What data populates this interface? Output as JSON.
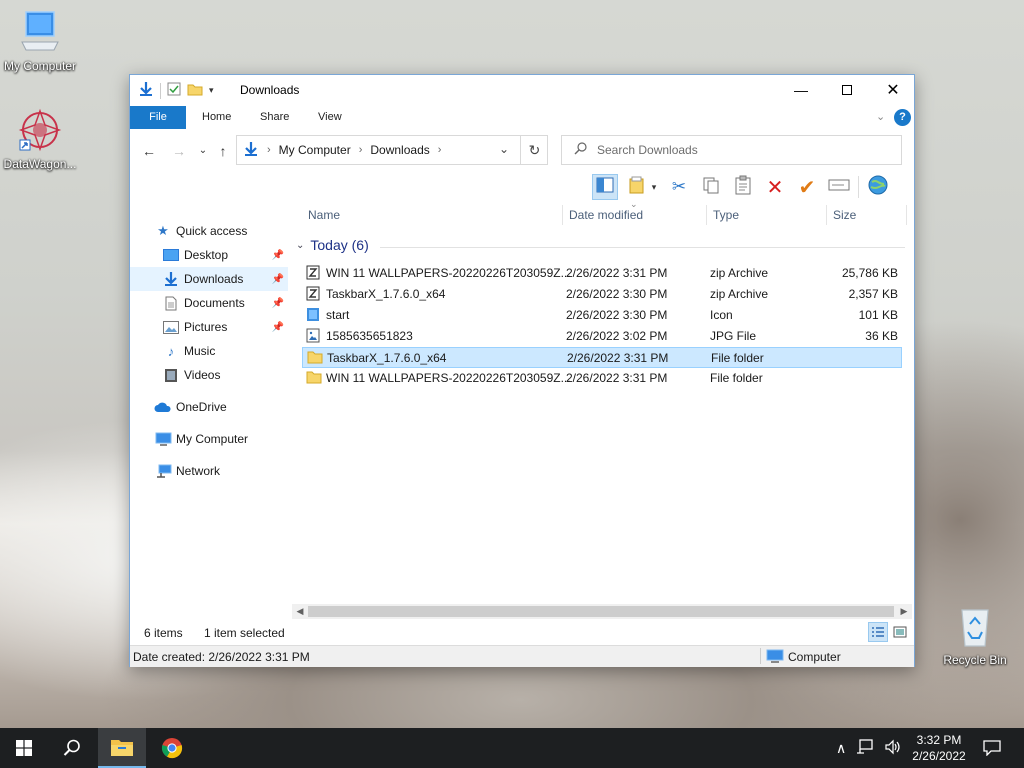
{
  "desktop": {
    "icons": [
      {
        "label": "My Computer"
      },
      {
        "label": "DataWagon..."
      },
      {
        "label": "Recycle Bin"
      }
    ]
  },
  "window": {
    "title": "Downloads",
    "ribbon_tabs": [
      "File",
      "Home",
      "Share",
      "View"
    ],
    "address": {
      "crumbs": [
        "My Computer",
        "Downloads"
      ]
    },
    "search": {
      "placeholder": "Search Downloads"
    },
    "nav": {
      "quick_access": "Quick access",
      "items": [
        {
          "label": "Desktop",
          "pinned": true
        },
        {
          "label": "Downloads",
          "pinned": true,
          "selected": true
        },
        {
          "label": "Documents",
          "pinned": true
        },
        {
          "label": "Pictures",
          "pinned": true
        },
        {
          "label": "Music",
          "pinned": false
        },
        {
          "label": "Videos",
          "pinned": false
        }
      ],
      "onedrive": "OneDrive",
      "my_computer": "My Computer",
      "network": "Network"
    },
    "columns": {
      "name": "Name",
      "date": "Date modified",
      "type": "Type",
      "size": "Size"
    },
    "group_label": "Today (6)",
    "files": [
      {
        "name": "WIN 11 WALLPAPERS-20220226T203059Z...",
        "date": "2/26/2022 3:31 PM",
        "type": "zip Archive",
        "size": "25,786 KB",
        "icon": "zip-icon"
      },
      {
        "name": "TaskbarX_1.7.6.0_x64",
        "date": "2/26/2022 3:30 PM",
        "type": "zip Archive",
        "size": "2,357 KB",
        "icon": "zip-icon"
      },
      {
        "name": "start",
        "date": "2/26/2022 3:30 PM",
        "type": "Icon",
        "size": "101 KB",
        "icon": "ico-file-icon"
      },
      {
        "name": "1585635651823",
        "date": "2/26/2022 3:02 PM",
        "type": "JPG File",
        "size": "36 KB",
        "icon": "image-file-icon"
      },
      {
        "name": "TaskbarX_1.7.6.0_x64",
        "date": "2/26/2022 3:31 PM",
        "type": "File folder",
        "size": "",
        "icon": "folder-icon",
        "selected": true
      },
      {
        "name": "WIN 11 WALLPAPERS-20220226T203059Z...",
        "date": "2/26/2022 3:31 PM",
        "type": "File folder",
        "size": "",
        "icon": "folder-icon"
      }
    ],
    "status": {
      "items": "6 items",
      "selected": "1 item selected"
    },
    "details": {
      "date_created": "Date created: 2/26/2022 3:31 PM",
      "location": "Computer"
    }
  },
  "taskbar": {
    "time": "3:32 PM",
    "date": "2/26/2022"
  },
  "colors": {
    "accent": "#1979ca",
    "selection": "#cce8ff",
    "group_text": "#1e3287",
    "taskbar": "#1d1f21"
  }
}
